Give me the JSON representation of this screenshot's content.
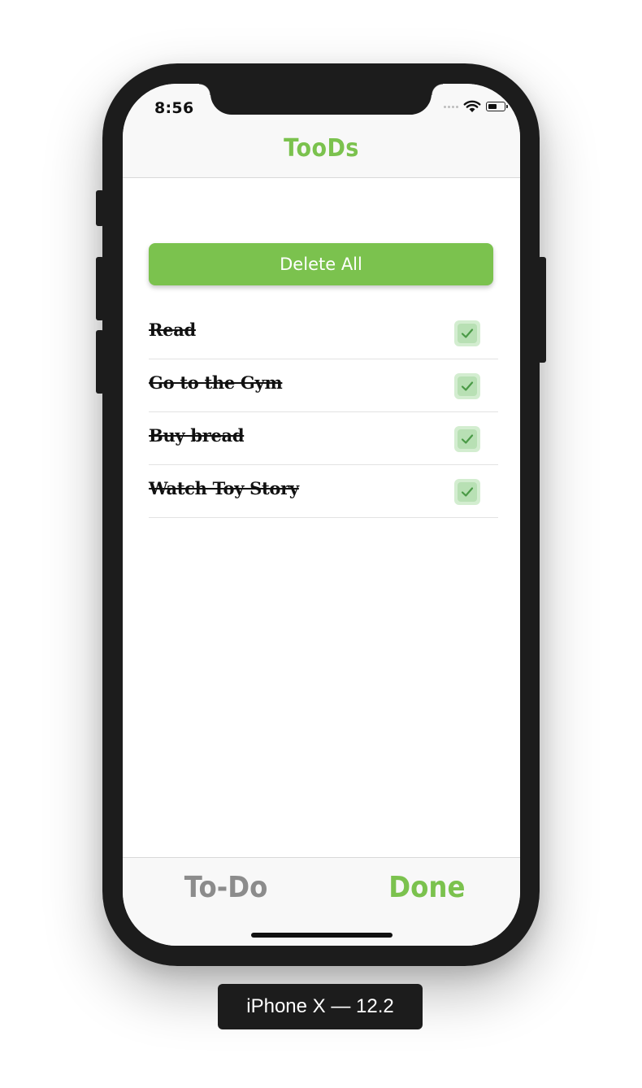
{
  "status_bar": {
    "time": "8:56"
  },
  "nav": {
    "title": "TooDs"
  },
  "actions": {
    "delete_all_label": "Delete All"
  },
  "tasks": [
    {
      "label": "Read",
      "done": true
    },
    {
      "label": "Go to the Gym",
      "done": true
    },
    {
      "label": "Buy bread",
      "done": true
    },
    {
      "label": "Watch Toy Story",
      "done": true
    }
  ],
  "tab_bar": {
    "items": [
      {
        "label": "To-Do",
        "selected": false
      },
      {
        "label": "Done",
        "selected": true
      }
    ]
  },
  "device": {
    "label": "iPhone X — 12.2"
  },
  "colors": {
    "accent": "#7bc24e",
    "inactive_tab": "#8c8c8c",
    "check_bg": "#d3edd0"
  },
  "icons": {
    "status": [
      "cellular-signal-icon",
      "wifi-icon",
      "battery-icon"
    ],
    "task": "checkmark-icon"
  }
}
